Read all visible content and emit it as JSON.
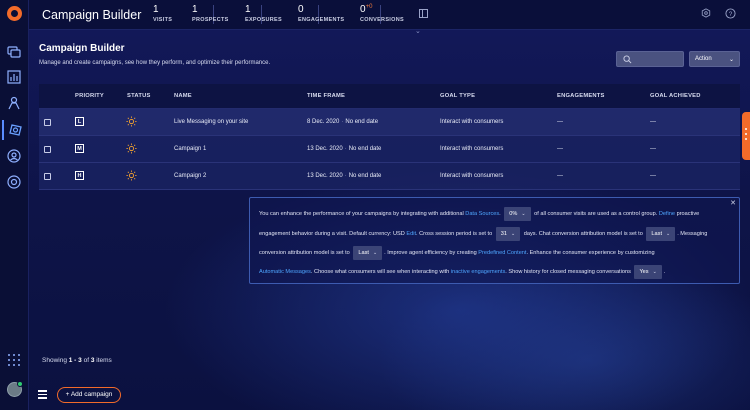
{
  "topbar": {
    "title": "Campaign Builder",
    "metrics": [
      {
        "value": "1",
        "label": "VISITS"
      },
      {
        "value": "1",
        "label": "PROSPECTS"
      },
      {
        "value": "1",
        "label": "EXPOSURES"
      },
      {
        "value": "0",
        "label": "ENGAGEMENTS"
      },
      {
        "value": "0",
        "delta": "+0",
        "label": "CONVERSIONS"
      }
    ]
  },
  "page": {
    "title": "Campaign Builder",
    "subtitle": "Manage and create campaigns, see how they perform, and optimize their performance.",
    "action_label": "Action"
  },
  "table": {
    "headers": [
      "PRIORITY",
      "STATUS",
      "NAME",
      "TIME FRAME",
      "GOAL TYPE",
      "ENGAGEMENTS",
      "GOAL ACHIEVED"
    ],
    "rows": [
      {
        "priority": "L",
        "name": "Live Messaging on your site",
        "start": "8 Dec. 2020",
        "end": "No end date",
        "goal": "Interact with consumers",
        "engagements": "—",
        "achieved": "—"
      },
      {
        "priority": "M",
        "name": "Campaign 1",
        "start": "13 Dec. 2020",
        "end": "No end date",
        "goal": "Interact with consumers",
        "engagements": "—",
        "achieved": "—"
      },
      {
        "priority": "H",
        "name": "Campaign 2",
        "start": "13 Dec. 2020",
        "end": "No end date",
        "goal": "Interact with consumers",
        "engagements": "—",
        "achieved": "—"
      }
    ]
  },
  "info": {
    "l1a": "You can enhance the performance of your campaigns by integrating with additional",
    "l1link": "Data Sources",
    "l1b": ".",
    "dd1": "0%",
    "l1c": "of all consumer visits are used as a control group.",
    "l1link2": "Define",
    "l1d": "proactive",
    "l2a": "engagement behavior during a visit. Default currency: USD",
    "l2link": "Edit",
    "l2b": ". Cross session period is set to",
    "dd2": "31",
    "l2c": "days. Chat conversion attribution model is set to",
    "dd3": "Last",
    "l2d": ". Messaging",
    "l3a": "conversion attribution model is set to",
    "dd4": "Last",
    "l3b": ". Improve agent efficiency by creating",
    "l3link": "Predefined Content",
    "l3c": ". Enhance the consumer experience by customizing",
    "l4link": "Automatic Messages",
    "l4a": ". Choose what consumers will see when interacting with",
    "l4link2": "inactive engagements",
    "l4b": ". Show history for closed messaging conversations",
    "dd5": "Yes",
    "l4c": "."
  },
  "footer": {
    "showing_prefix": "Showing",
    "range": "1 - 3",
    "of": "of",
    "total": "3",
    "items": "items",
    "add_label": "+ Add campaign"
  },
  "colors": {
    "accent": "#f26b2a",
    "link": "#4fa6ff",
    "background": "#0c1140"
  }
}
